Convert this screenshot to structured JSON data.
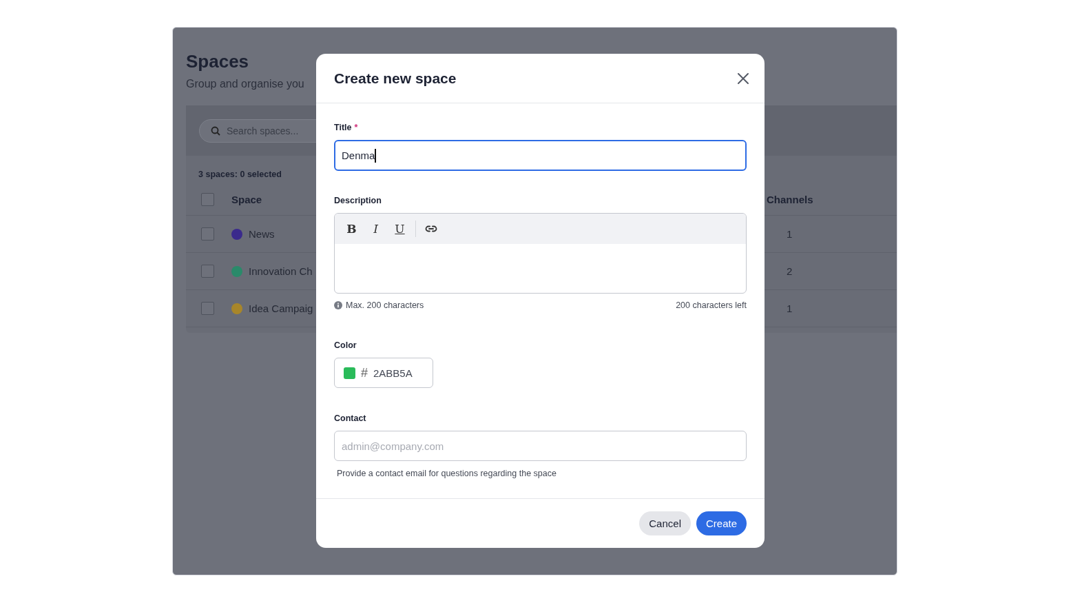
{
  "page": {
    "title": "Spaces",
    "subtitle": "Group and organise you"
  },
  "search": {
    "placeholder": "Search spaces..."
  },
  "table": {
    "summary": "3 spaces: 0 selected",
    "all_checked": false,
    "columns": [
      "Space",
      "Channels"
    ],
    "rows": [
      {
        "name": "News",
        "color": "#3a2a8c",
        "channels": "1",
        "checked": false
      },
      {
        "name": "Innovation Ch",
        "color": "#2a8a6a",
        "channels": "2",
        "checked": false
      },
      {
        "name": "Idea Campaig",
        "color": "#a8862a",
        "channels": "1",
        "checked": false
      }
    ]
  },
  "dialog": {
    "title": "Create new space",
    "title_field": {
      "label": "Title",
      "required_mark": "*",
      "value": "Denma",
      "focused": true
    },
    "description": {
      "label": "Description",
      "toolbar": [
        {
          "kind": "bold",
          "label": "B"
        },
        {
          "kind": "italic",
          "label": "I"
        },
        {
          "kind": "underline",
          "label": "U"
        },
        {
          "kind": "link"
        }
      ],
      "hint": "Max. 200 characters",
      "counter": "200 characters left"
    },
    "color": {
      "label": "Color",
      "prefix": "#",
      "value": "2ABB5A"
    },
    "contact": {
      "label": "Contact",
      "placeholder": "admin@company.com",
      "help": "Provide a contact email for questions regarding the space"
    },
    "buttons": [
      {
        "kind": "secondary",
        "label": "Cancel"
      },
      {
        "kind": "primary",
        "label": "Create"
      }
    ]
  }
}
